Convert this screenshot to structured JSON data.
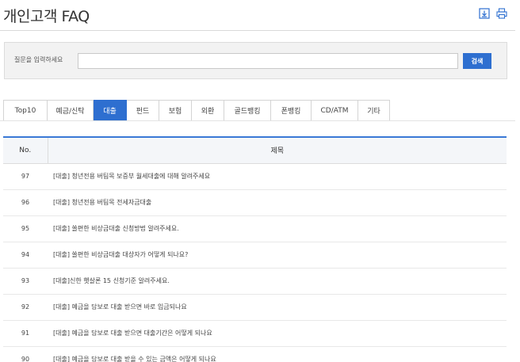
{
  "header": {
    "title": "개인고객 FAQ",
    "icons": [
      "download-icon",
      "print-icon"
    ]
  },
  "search": {
    "label": "질문을 입력하세요",
    "value": "",
    "placeholder": "",
    "button_label": "검색"
  },
  "tabs": [
    {
      "label": "Top10",
      "active": false
    },
    {
      "label": "예금/신탁",
      "active": false
    },
    {
      "label": "대출",
      "active": true
    },
    {
      "label": "펀드",
      "active": false
    },
    {
      "label": "보험",
      "active": false
    },
    {
      "label": "외환",
      "active": false
    },
    {
      "label": "골드뱅킹",
      "active": false
    },
    {
      "label": "폰뱅킹",
      "active": false
    },
    {
      "label": "CD/ATM",
      "active": false
    },
    {
      "label": "기타",
      "active": false
    }
  ],
  "table": {
    "columns": [
      "No.",
      "제목"
    ],
    "rows": [
      {
        "no": "97",
        "title": "[대출] 청년전용 버팀목 보증부 월세대출에 대해 알려주세요"
      },
      {
        "no": "96",
        "title": "[대출] 청년전용 버팀목 전세자금대출"
      },
      {
        "no": "95",
        "title": "[대출] 쏠편한 비상금대출 신청방법 알려주세요."
      },
      {
        "no": "94",
        "title": "[대출] 쏠편한 비상금대출 대상자가 어떻게 되나요?"
      },
      {
        "no": "93",
        "title": "[대출]신한 햇살론 15 신청기준 알려주세요."
      },
      {
        "no": "92",
        "title": "[대출] 예금을 담보로 대출 받으면 바로 입금되나요"
      },
      {
        "no": "91",
        "title": "[대출] 예금을 담보로 대출 받으면 대출기간은 어떻게 되나요"
      },
      {
        "no": "90",
        "title": "[대출] 예금을 담보로 대출 받을 수 있는 금액은 어떻게 되나요"
      }
    ]
  },
  "colors": {
    "accent": "#2e6fd0",
    "header_border": "#3a78d6",
    "search_bg": "#f2f2f2"
  }
}
